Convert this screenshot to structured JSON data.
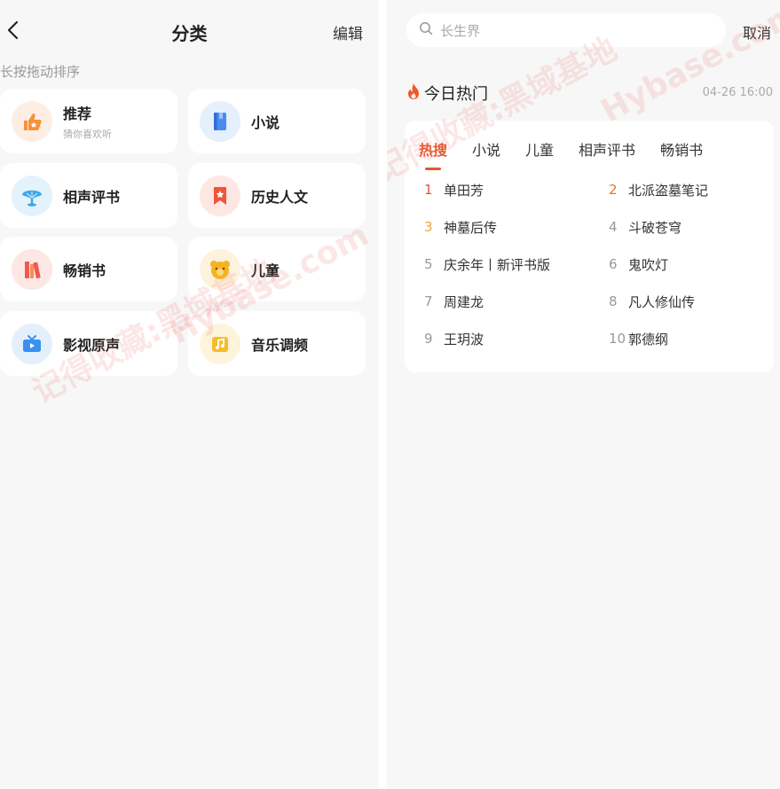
{
  "category_page": {
    "title": "分类",
    "edit_label": "编辑",
    "hint": "长按拖动排序",
    "items": [
      {
        "name": "推荐",
        "sub": "猜你喜欢听",
        "icon": "thumbs-up-icon",
        "color": "#f7923a",
        "bg": "#fdeee3"
      },
      {
        "name": "小说",
        "icon": "book-icon",
        "color": "#4a8cf0",
        "bg": "#e6effc"
      },
      {
        "name": "相声评书",
        "icon": "fan-icon",
        "color": "#3aa7e8",
        "bg": "#e4f2fb"
      },
      {
        "name": "历史人文",
        "icon": "bookmark-star-icon",
        "color": "#f0553a",
        "bg": "#fde7e3"
      },
      {
        "name": "畅销书",
        "icon": "books-icon",
        "color": "#ef5a4a",
        "bg": "#fde7e4"
      },
      {
        "name": "儿童",
        "icon": "bear-icon",
        "color": "#f5b324",
        "bg": "#fdf3dc"
      },
      {
        "name": "影视原声",
        "icon": "tv-icon",
        "color": "#3a8ff0",
        "bg": "#e4effc"
      },
      {
        "name": "音乐调频",
        "icon": "music-note-icon",
        "color": "#f5bd2a",
        "bg": "#fdf4dc"
      }
    ]
  },
  "search_page": {
    "search_placeholder": "长生界",
    "cancel_label": "取消",
    "hot_title": "今日热门",
    "hot_time": "04-26 16:00",
    "tabs": [
      "热搜",
      "小说",
      "儿童",
      "相声评书",
      "畅销书"
    ],
    "active_tab": 0,
    "ranking": [
      {
        "rank": "1",
        "title": "单田芳"
      },
      {
        "rank": "2",
        "title": "北派盗墓笔记"
      },
      {
        "rank": "3",
        "title": "神墓后传"
      },
      {
        "rank": "4",
        "title": "斗破苍穹"
      },
      {
        "rank": "5",
        "title": "庆余年丨新评书版"
      },
      {
        "rank": "6",
        "title": "鬼吹灯"
      },
      {
        "rank": "7",
        "title": "周建龙"
      },
      {
        "rank": "8",
        "title": "凡人修仙传"
      },
      {
        "rank": "9",
        "title": "王玥波"
      },
      {
        "rank": "10",
        "title": "郭德纲"
      }
    ]
  },
  "watermark": {
    "text_a": "记得收藏:黑域基地",
    "text_b": "Hybase.com"
  },
  "colors": {
    "accent": "#e4572e",
    "rank1": "#e8533a",
    "rank2": "#f0702f",
    "rank3": "#f5a43c"
  }
}
